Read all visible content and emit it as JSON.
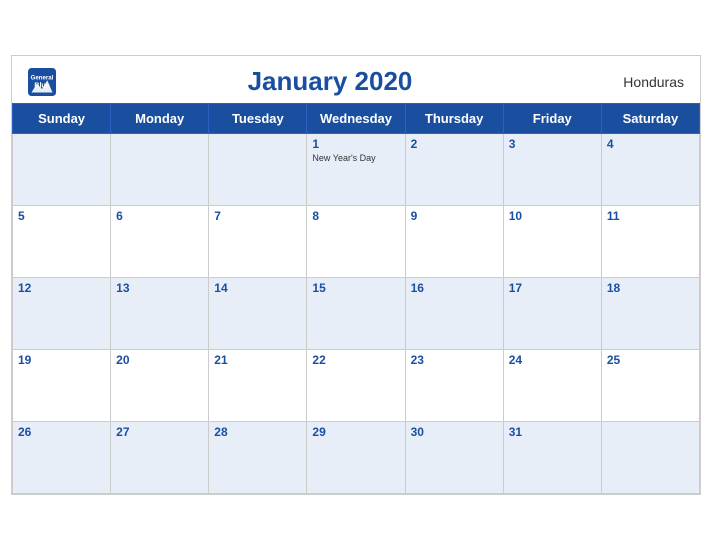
{
  "header": {
    "logo_general": "General",
    "logo_blue": "Blue",
    "title": "January 2020",
    "country": "Honduras"
  },
  "days_of_week": [
    "Sunday",
    "Monday",
    "Tuesday",
    "Wednesday",
    "Thursday",
    "Friday",
    "Saturday"
  ],
  "weeks": [
    [
      {
        "day": "",
        "holiday": ""
      },
      {
        "day": "",
        "holiday": ""
      },
      {
        "day": "",
        "holiday": ""
      },
      {
        "day": "1",
        "holiday": "New Year's Day"
      },
      {
        "day": "2",
        "holiday": ""
      },
      {
        "day": "3",
        "holiday": ""
      },
      {
        "day": "4",
        "holiday": ""
      }
    ],
    [
      {
        "day": "5",
        "holiday": ""
      },
      {
        "day": "6",
        "holiday": ""
      },
      {
        "day": "7",
        "holiday": ""
      },
      {
        "day": "8",
        "holiday": ""
      },
      {
        "day": "9",
        "holiday": ""
      },
      {
        "day": "10",
        "holiday": ""
      },
      {
        "day": "11",
        "holiday": ""
      }
    ],
    [
      {
        "day": "12",
        "holiday": ""
      },
      {
        "day": "13",
        "holiday": ""
      },
      {
        "day": "14",
        "holiday": ""
      },
      {
        "day": "15",
        "holiday": ""
      },
      {
        "day": "16",
        "holiday": ""
      },
      {
        "day": "17",
        "holiday": ""
      },
      {
        "day": "18",
        "holiday": ""
      }
    ],
    [
      {
        "day": "19",
        "holiday": ""
      },
      {
        "day": "20",
        "holiday": ""
      },
      {
        "day": "21",
        "holiday": ""
      },
      {
        "day": "22",
        "holiday": ""
      },
      {
        "day": "23",
        "holiday": ""
      },
      {
        "day": "24",
        "holiday": ""
      },
      {
        "day": "25",
        "holiday": ""
      }
    ],
    [
      {
        "day": "26",
        "holiday": ""
      },
      {
        "day": "27",
        "holiday": ""
      },
      {
        "day": "28",
        "holiday": ""
      },
      {
        "day": "29",
        "holiday": ""
      },
      {
        "day": "30",
        "holiday": ""
      },
      {
        "day": "31",
        "holiday": ""
      },
      {
        "day": "",
        "holiday": ""
      }
    ]
  ]
}
